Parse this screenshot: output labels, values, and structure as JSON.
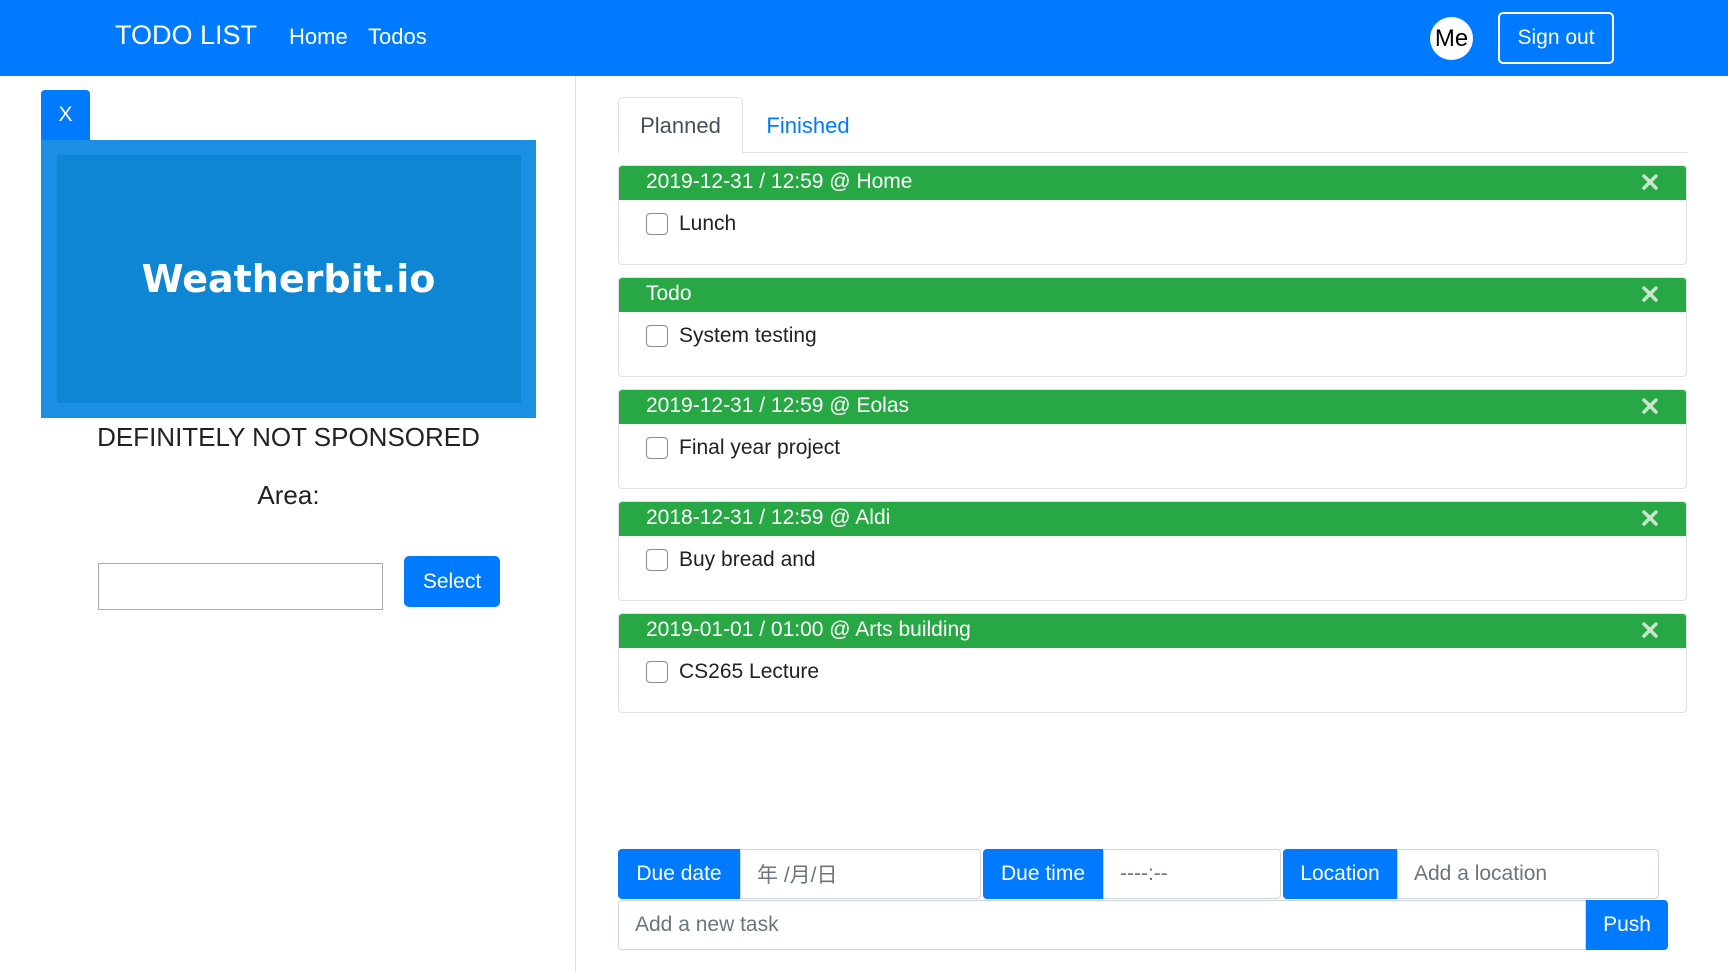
{
  "navbar": {
    "brand": "TODO LIST",
    "links": [
      "Home",
      "Todos"
    ],
    "avatar": "Me",
    "signout": "Sign out",
    "color": "#007bff"
  },
  "sidebar": {
    "close": "X",
    "ad_logo": "Weatherbit.io",
    "sponsor": "DEFINITELY NOT SPONSORED",
    "area_label": "Area:",
    "area_value": "",
    "select": "Select"
  },
  "tabs": [
    "Planned",
    "Finished"
  ],
  "todos": [
    {
      "header": "2019-12-31 / 12:59 @ Home",
      "task": "Lunch"
    },
    {
      "header": "Todo",
      "task": "System testing"
    },
    {
      "header": "2019-12-31 / 12:59 @ Eolas",
      "task": "Final year project"
    },
    {
      "header": "2018-12-31 / 12:59 @ Aldi",
      "task": "Buy bread and"
    },
    {
      "header": "2019-01-01 / 01:00 @ Arts building",
      "task": "CS265 Lecture"
    }
  ],
  "form": {
    "due_date_label": "Due date",
    "due_date_placeholder": "年 /月/日",
    "due_time_label": "Due time",
    "due_time_placeholder": "----:--",
    "location_label": "Location",
    "location_placeholder": "Add a location",
    "task_placeholder": "Add a new task",
    "push": "Push"
  },
  "colors": {
    "primary": "#007bff",
    "success": "#28a745"
  }
}
